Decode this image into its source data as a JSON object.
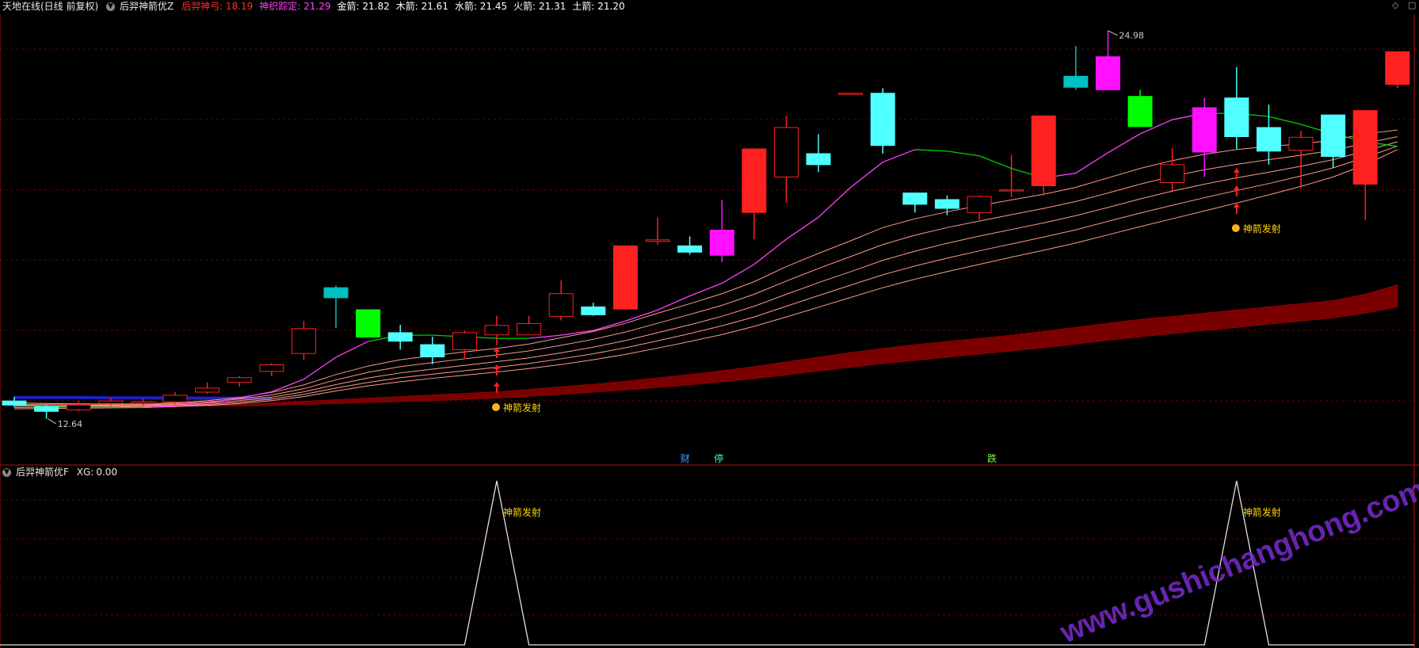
{
  "header": {
    "app_title": "天地在线(日线 前复权)",
    "indicator_name": "后羿神箭优Z",
    "metrics": [
      {
        "label": "后羿神弓",
        "value": "18.19",
        "color": "#ff3030"
      },
      {
        "label": "神织踪定",
        "value": "21.29",
        "color": "#ff40ff"
      },
      {
        "label": "金箭",
        "value": "21.82",
        "color": "#ffffff"
      },
      {
        "label": "木箭",
        "value": "21.61",
        "color": "#ffffff"
      },
      {
        "label": "水箭",
        "value": "21.45",
        "color": "#ffffff"
      },
      {
        "label": "火箭",
        "value": "21.31",
        "color": "#ffffff"
      },
      {
        "label": "土箭",
        "value": "21.20",
        "color": "#ffffff"
      }
    ],
    "corner_icons": [
      "◇",
      "▢"
    ]
  },
  "sub_header": {
    "indicator_name": "后羿神箭优F",
    "metrics": [
      {
        "label": "XG",
        "value": "0.00"
      }
    ]
  },
  "annotations": {
    "high_label": "24.98",
    "low_label": "12.64",
    "signal_label": "神箭发射",
    "marker_cai": "财",
    "marker_ting": "停",
    "marker_die": "跌"
  },
  "watermark": "www.gushichanghong.com",
  "colors": {
    "up": "#ff2020",
    "down": "#50ffff",
    "up_big": "#ff10ff",
    "cyan_dark": "#00c0c0",
    "green": "#00ff00",
    "ma_bull": "#ff40ff",
    "ma_bear": "#00d000",
    "ribbon": "#ff9a8a",
    "band": "#7a0000",
    "blue_line": "#2020c0",
    "grid": "#6a0000"
  },
  "chart_data": {
    "type": "candlestick",
    "ylim": [
      11.2,
      25.5
    ],
    "candles": [
      {
        "o": 13.21,
        "h": 13.34,
        "l": 13.02,
        "c": 13.08,
        "color": "cyan"
      },
      {
        "o": 13.03,
        "h": 13.08,
        "l": 12.64,
        "c": 12.88,
        "color": "cyan"
      },
      {
        "o": 12.93,
        "h": 13.21,
        "l": 12.88,
        "c": 13.08,
        "color": "hollow"
      },
      {
        "o": 13.13,
        "h": 13.31,
        "l": 13.05,
        "c": 13.21,
        "color": "hollow"
      },
      {
        "o": 13.13,
        "h": 13.28,
        "l": 13.05,
        "c": 13.18,
        "color": "hollow"
      },
      {
        "o": 13.18,
        "h": 13.49,
        "l": 13.1,
        "c": 13.39,
        "color": "hollow"
      },
      {
        "o": 13.49,
        "h": 13.8,
        "l": 13.44,
        "c": 13.62,
        "color": "hollow"
      },
      {
        "o": 13.8,
        "h": 14.0,
        "l": 13.67,
        "c": 13.95,
        "color": "hollow"
      },
      {
        "o": 14.15,
        "h": 14.41,
        "l": 14.0,
        "c": 14.36,
        "color": "hollow"
      },
      {
        "o": 14.72,
        "h": 15.75,
        "l": 14.51,
        "c": 15.51,
        "color": "hollow"
      },
      {
        "o": 16.81,
        "h": 16.88,
        "l": 15.53,
        "c": 16.49,
        "color": "cyan_dark"
      },
      {
        "o": 16.11,
        "h": 16.11,
        "l": 15.24,
        "c": 15.24,
        "color": "green"
      },
      {
        "o": 15.38,
        "h": 15.63,
        "l": 14.84,
        "c": 15.11,
        "color": "cyan"
      },
      {
        "o": 15.0,
        "h": 15.25,
        "l": 14.38,
        "c": 14.61,
        "color": "cyan"
      },
      {
        "o": 14.84,
        "h": 15.45,
        "l": 14.54,
        "c": 15.38,
        "color": "hollow"
      },
      {
        "o": 15.31,
        "h": 15.92,
        "l": 14.98,
        "c": 15.61,
        "color": "hollow"
      },
      {
        "o": 15.31,
        "h": 15.92,
        "l": 15.31,
        "c": 15.67,
        "color": "hollow"
      },
      {
        "o": 15.9,
        "h": 17.04,
        "l": 15.77,
        "c": 16.62,
        "color": "hollow"
      },
      {
        "o": 16.2,
        "h": 16.33,
        "l": 15.92,
        "c": 15.95,
        "color": "cyan"
      },
      {
        "o": 16.13,
        "h": 18.14,
        "l": 16.13,
        "c": 18.14,
        "color": "red"
      },
      {
        "o": 18.28,
        "h": 19.04,
        "l": 18.18,
        "c": 18.33,
        "color": "hollow"
      },
      {
        "o": 18.14,
        "h": 18.44,
        "l": 17.86,
        "c": 17.94,
        "color": "cyan"
      },
      {
        "o": 18.64,
        "h": 19.59,
        "l": 17.63,
        "c": 17.84,
        "color": "magenta"
      },
      {
        "o": 19.2,
        "h": 21.22,
        "l": 18.35,
        "c": 21.22,
        "color": "red"
      },
      {
        "o": 20.33,
        "h": 22.27,
        "l": 19.51,
        "c": 21.9,
        "color": "hollow"
      },
      {
        "o": 21.07,
        "h": 21.69,
        "l": 20.49,
        "c": 20.72,
        "color": "cyan"
      },
      {
        "o": 22.99,
        "h": 22.99,
        "l": 22.99,
        "c": 22.99,
        "color": "hollow"
      },
      {
        "o": 22.99,
        "h": 23.15,
        "l": 21.07,
        "c": 21.33,
        "color": "cyan"
      },
      {
        "o": 19.82,
        "h": 19.82,
        "l": 19.2,
        "c": 19.46,
        "color": "cyan"
      },
      {
        "o": 19.61,
        "h": 19.74,
        "l": 19.12,
        "c": 19.33,
        "color": "cyan"
      },
      {
        "o": 19.2,
        "h": 19.74,
        "l": 18.97,
        "c": 19.71,
        "color": "hollow"
      },
      {
        "o": 19.92,
        "h": 21.03,
        "l": 19.69,
        "c": 19.92,
        "color": "hollow"
      },
      {
        "o": 20.05,
        "h": 22.27,
        "l": 19.74,
        "c": 22.27,
        "color": "red"
      },
      {
        "o": 23.53,
        "h": 24.49,
        "l": 23.1,
        "c": 23.18,
        "color": "cyan_dark"
      },
      {
        "o": 23.1,
        "h": 24.98,
        "l": 23.1,
        "c": 24.15,
        "color": "magenta"
      },
      {
        "o": 22.89,
        "h": 23.1,
        "l": 21.93,
        "c": 21.93,
        "color": "green"
      },
      {
        "o": 20.15,
        "h": 21.25,
        "l": 19.9,
        "c": 20.72,
        "color": "hollow"
      },
      {
        "o": 21.12,
        "h": 22.84,
        "l": 20.33,
        "c": 22.53,
        "color": "magenta"
      },
      {
        "o": 22.84,
        "h": 23.82,
        "l": 21.22,
        "c": 21.61,
        "color": "cyan"
      },
      {
        "o": 21.9,
        "h": 22.63,
        "l": 20.72,
        "c": 21.15,
        "color": "cyan"
      },
      {
        "o": 21.18,
        "h": 21.8,
        "l": 19.97,
        "c": 21.59,
        "color": "hollow"
      },
      {
        "o": 22.3,
        "h": 22.3,
        "l": 20.62,
        "c": 20.98,
        "color": "cyan"
      },
      {
        "o": 20.1,
        "h": 22.44,
        "l": 18.97,
        "c": 22.44,
        "color": "red"
      },
      {
        "o": 23.27,
        "h": 24.31,
        "l": 23.15,
        "c": 24.31,
        "color": "red"
      }
    ],
    "ma": [
      13.1,
      13.05,
      13.02,
      13.0,
      13.0,
      13.05,
      13.15,
      13.3,
      13.5,
      13.9,
      14.6,
      15.1,
      15.3,
      15.3,
      15.25,
      15.2,
      15.2,
      15.3,
      15.45,
      15.75,
      16.1,
      16.55,
      16.95,
      17.55,
      18.35,
      19.05,
      20.0,
      20.8,
      21.2,
      21.15,
      21.0,
      20.6,
      20.3,
      20.45,
      21.1,
      21.7,
      22.15,
      22.35,
      22.35,
      22.25,
      22.0,
      21.7,
      21.45,
      21.3
    ],
    "ma_trend": [
      1,
      -1,
      -1,
      -1,
      -1,
      1,
      1,
      1,
      1,
      1,
      1,
      1,
      -1,
      -1,
      -1,
      -1,
      -1,
      1,
      1,
      1,
      1,
      1,
      1,
      1,
      1,
      1,
      1,
      1,
      1,
      -1,
      -1,
      -1,
      -1,
      1,
      1,
      1,
      1,
      1,
      -1,
      -1,
      -1,
      -1,
      -1,
      -1
    ],
    "ribbon_lines": [
      [
        13.15,
        13.13,
        13.12,
        13.11,
        13.12,
        13.15,
        13.22,
        13.32,
        13.48,
        13.72,
        14.05,
        14.32,
        14.52,
        14.65,
        14.77,
        14.88,
        15.02,
        15.22,
        15.42,
        15.68,
        16.0,
        16.3,
        16.62,
        17.0,
        17.48,
        17.9,
        18.3,
        18.72,
        19.0,
        19.22,
        19.42,
        19.6,
        19.78,
        20.0,
        20.3,
        20.6,
        20.85,
        21.05,
        21.2,
        21.3,
        21.38,
        21.5,
        21.7,
        21.82
      ],
      [
        13.1,
        13.09,
        13.08,
        13.08,
        13.09,
        13.12,
        13.18,
        13.27,
        13.4,
        13.6,
        13.88,
        14.12,
        14.3,
        14.43,
        14.55,
        14.67,
        14.8,
        14.98,
        15.17,
        15.4,
        15.68,
        15.96,
        16.25,
        16.6,
        17.02,
        17.42,
        17.8,
        18.18,
        18.48,
        18.72,
        18.93,
        19.13,
        19.33,
        19.55,
        19.82,
        20.1,
        20.35,
        20.56,
        20.73,
        20.88,
        21.02,
        21.18,
        21.4,
        21.61
      ],
      [
        13.05,
        13.05,
        13.05,
        13.05,
        13.06,
        13.09,
        13.14,
        13.22,
        13.33,
        13.5,
        13.73,
        13.94,
        14.1,
        14.22,
        14.34,
        14.46,
        14.58,
        14.74,
        14.92,
        15.13,
        15.38,
        15.63,
        15.9,
        16.22,
        16.6,
        16.97,
        17.32,
        17.68,
        17.97,
        18.22,
        18.45,
        18.66,
        18.87,
        19.1,
        19.36,
        19.63,
        19.88,
        20.1,
        20.3,
        20.48,
        20.67,
        20.88,
        21.15,
        21.45
      ],
      [
        13.0,
        13.01,
        13.02,
        13.02,
        13.03,
        13.06,
        13.1,
        13.17,
        13.27,
        13.42,
        13.62,
        13.8,
        13.95,
        14.06,
        14.17,
        14.28,
        14.4,
        14.55,
        14.71,
        14.9,
        15.12,
        15.35,
        15.6,
        15.88,
        16.22,
        16.56,
        16.89,
        17.22,
        17.5,
        17.75,
        17.98,
        18.2,
        18.42,
        18.65,
        18.92,
        19.18,
        19.43,
        19.67,
        19.9,
        20.12,
        20.36,
        20.62,
        20.95,
        21.31
      ],
      [
        12.96,
        12.97,
        12.98,
        12.99,
        13.0,
        13.03,
        13.07,
        13.13,
        13.22,
        13.35,
        13.53,
        13.69,
        13.82,
        13.93,
        14.03,
        14.13,
        14.24,
        14.37,
        14.52,
        14.69,
        14.89,
        15.1,
        15.32,
        15.58,
        15.88,
        16.19,
        16.5,
        16.81,
        17.08,
        17.32,
        17.55,
        17.78,
        18.0,
        18.23,
        18.49,
        18.75,
        19.0,
        19.25,
        19.5,
        19.76,
        20.03,
        20.33,
        20.72,
        21.2
      ]
    ],
    "band_top": [
      13.1,
      13.1,
      13.1,
      13.1,
      13.1,
      13.1,
      13.1,
      13.1,
      13.15,
      13.2,
      13.25,
      13.3,
      13.35,
      13.4,
      13.45,
      13.5,
      13.58,
      13.66,
      13.74,
      13.84,
      13.94,
      14.05,
      14.17,
      14.3,
      14.45,
      14.6,
      14.75,
      14.88,
      15.0,
      15.1,
      15.2,
      15.3,
      15.42,
      15.55,
      15.68,
      15.8,
      15.9,
      16.0,
      16.1,
      16.2,
      16.3,
      16.4,
      16.6,
      16.9
    ],
    "band_bottom": [
      13.05,
      13.05,
      13.05,
      13.05,
      13.05,
      13.05,
      13.05,
      13.05,
      13.07,
      13.1,
      13.13,
      13.16,
      13.19,
      13.22,
      13.26,
      13.3,
      13.36,
      13.42,
      13.49,
      13.56,
      13.64,
      13.72,
      13.82,
      13.92,
      14.04,
      14.16,
      14.28,
      14.4,
      14.5,
      14.6,
      14.7,
      14.8,
      14.9,
      15.02,
      15.14,
      15.25,
      15.35,
      15.45,
      15.55,
      15.65,
      15.75,
      15.85,
      16.0,
      16.2
    ],
    "blue_line": [
      13.32,
      13.32,
      13.32,
      13.31,
      13.31,
      13.3,
      13.3,
      13.3,
      13.28
    ],
    "signals": [
      15,
      38
    ],
    "xg": [
      0,
      0,
      0,
      0,
      0,
      0,
      0,
      0,
      0,
      0,
      0,
      0,
      0,
      0,
      0,
      1,
      0,
      0,
      0,
      0,
      0,
      0,
      0,
      0,
      0,
      0,
      0,
      0,
      0,
      0,
      0,
      0,
      0,
      0,
      0,
      0,
      0,
      0,
      1,
      0,
      0,
      0,
      0,
      0
    ]
  }
}
